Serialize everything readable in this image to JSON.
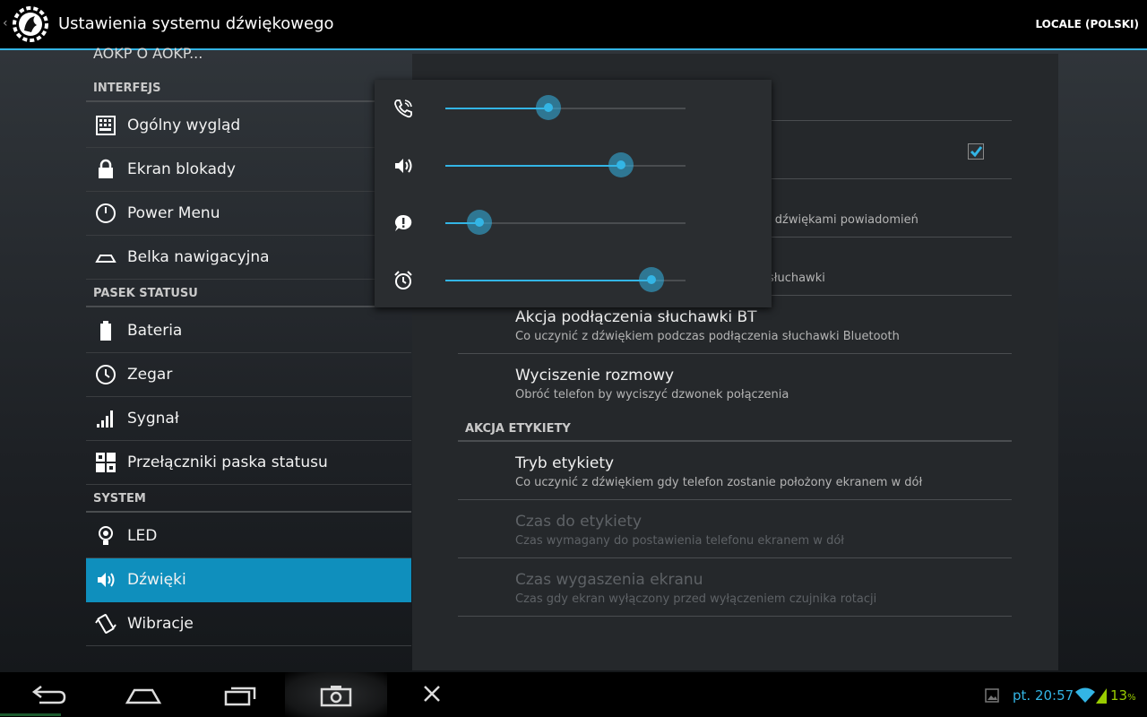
{
  "action_bar": {
    "title": "Ustawienia systemu dźwiękowego",
    "action_label": "LOCALE (POLSKI)"
  },
  "left_list": {
    "cut_item": "AOKP O AOKP...",
    "sections": [
      {
        "header": "INTERFEJS",
        "items": [
          {
            "label": "Ogólny wygląd",
            "icon": "grid-keyboard-icon"
          },
          {
            "label": "Ekran blokady",
            "icon": "lock-icon"
          },
          {
            "label": "Power Menu",
            "icon": "power-icon"
          },
          {
            "label": "Belka nawigacyjna",
            "icon": "navbar-icon"
          }
        ]
      },
      {
        "header": "PASEK STATUSU",
        "items": [
          {
            "label": "Bateria",
            "icon": "battery-icon"
          },
          {
            "label": "Zegar",
            "icon": "clock-icon"
          },
          {
            "label": "Sygnał",
            "icon": "signal-icon"
          },
          {
            "label": "Przełączniki paska statusu",
            "icon": "toggles-icon"
          }
        ]
      },
      {
        "header": "SYSTEM",
        "items": [
          {
            "label": "LED",
            "icon": "bulb-icon"
          },
          {
            "label": "Dźwięki",
            "icon": "speaker-icon",
            "selected": true
          },
          {
            "label": "Wibracje",
            "icon": "vibrate-icon"
          }
        ]
      }
    ]
  },
  "right_panel": {
    "partial_summary_1": "i dźwiękami powiadomień",
    "partial_summary_2": "słuchawki",
    "checkbox_checked": true,
    "prefs": [
      {
        "title": "Akcja podłączenia słuchawki BT",
        "summary": "Co uczynić z dźwiękiem podczas podłączenia słuchawki Bluetooth"
      },
      {
        "title": "Wyciszenie rozmowy",
        "summary": "Obróć telefon by wyciszyć dzwonek połączenia"
      }
    ],
    "category": "AKCJA ETYKIETY",
    "prefs2": [
      {
        "title": "Tryb etykiety",
        "summary": "Co uczynić z dźwiękiem gdy telefon zostanie położony ekranem w dół"
      },
      {
        "title": "Czas do etykiety",
        "summary": "Czas wymagany do postawienia telefonu ekranem w dół",
        "disabled": true
      },
      {
        "title": "Czas wygaszenia ekranu",
        "summary": "Czas gdy ekran wyłączony przed wyłączeniem czujnika rotacji",
        "disabled": true
      }
    ]
  },
  "volume_panel": {
    "sliders": [
      {
        "icon": "phone-icon",
        "level": 0.43
      },
      {
        "icon": "media-speaker-icon",
        "level": 0.73
      },
      {
        "icon": "notification-icon",
        "level": 0.14
      },
      {
        "icon": "alarm-icon",
        "level": 0.86
      }
    ]
  },
  "status_bar": {
    "clock": "pt. 20:57",
    "battery": "13",
    "battery_unit": "%"
  },
  "colors": {
    "accent": "#33b5e5",
    "selected": "#0f8fbd",
    "battery": "#99cc00"
  }
}
